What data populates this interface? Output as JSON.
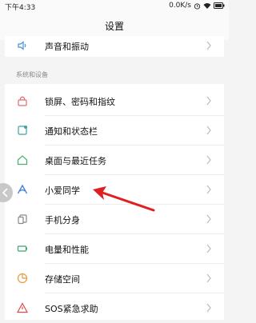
{
  "status": {
    "time": "下午4:33",
    "speed": "0.0K/s"
  },
  "title": "设置",
  "top_item": {
    "label": "声音和振动"
  },
  "section_header": "系统和设备",
  "items": [
    {
      "label": "锁屏、密码和指纹"
    },
    {
      "label": "通知和状态栏"
    },
    {
      "label": "桌面与最近任务"
    },
    {
      "label": "小爱同学"
    },
    {
      "label": "手机分身"
    },
    {
      "label": "电量和性能"
    },
    {
      "label": "存储空间"
    },
    {
      "label": "SOS紧急求助"
    }
  ],
  "colors": {
    "accent": "#ee5a5a",
    "arrow": "#e02020"
  }
}
